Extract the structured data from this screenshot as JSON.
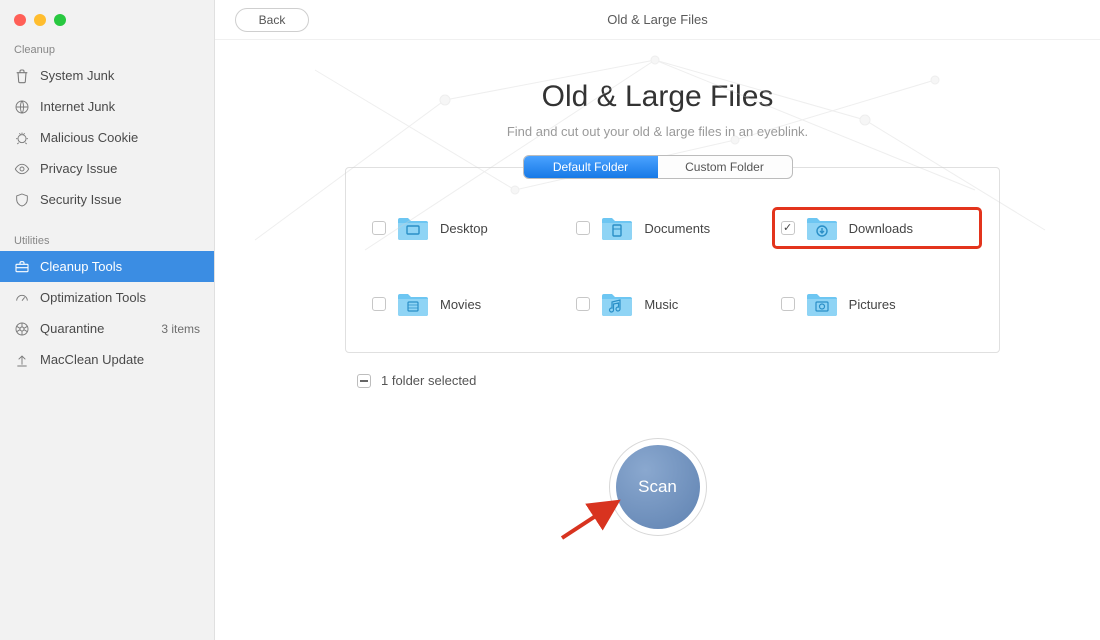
{
  "window": {
    "back_label": "Back",
    "topbar_title": "Old & Large Files"
  },
  "sidebar": {
    "sections": {
      "cleanup_label": "Cleanup",
      "utilities_label": "Utilities"
    },
    "cleanup": [
      {
        "label": "System Junk"
      },
      {
        "label": "Internet Junk"
      },
      {
        "label": "Malicious Cookie"
      },
      {
        "label": "Privacy Issue"
      },
      {
        "label": "Security Issue"
      }
    ],
    "utilities": [
      {
        "label": "Cleanup Tools",
        "active": true
      },
      {
        "label": "Optimization Tools"
      },
      {
        "label": "Quarantine",
        "badge": "3 items"
      },
      {
        "label": "MacClean Update"
      }
    ]
  },
  "hero": {
    "title": "Old & Large Files",
    "subtitle": "Find and cut out your old & large files in an eyeblink."
  },
  "tabs": {
    "default": "Default Folder",
    "custom": "Custom Folder"
  },
  "folders": [
    {
      "label": "Desktop",
      "checked": false,
      "highlight": false
    },
    {
      "label": "Documents",
      "checked": false,
      "highlight": false
    },
    {
      "label": "Downloads",
      "checked": true,
      "highlight": true
    },
    {
      "label": "Movies",
      "checked": false,
      "highlight": false
    },
    {
      "label": "Music",
      "checked": false,
      "highlight": false
    },
    {
      "label": "Pictures",
      "checked": false,
      "highlight": false
    }
  ],
  "selection_text": "1 folder selected",
  "scan_label": "Scan",
  "icons": {
    "colors": {
      "folder": "#6dc6f2",
      "folder_dark": "#4fb4e6"
    }
  }
}
